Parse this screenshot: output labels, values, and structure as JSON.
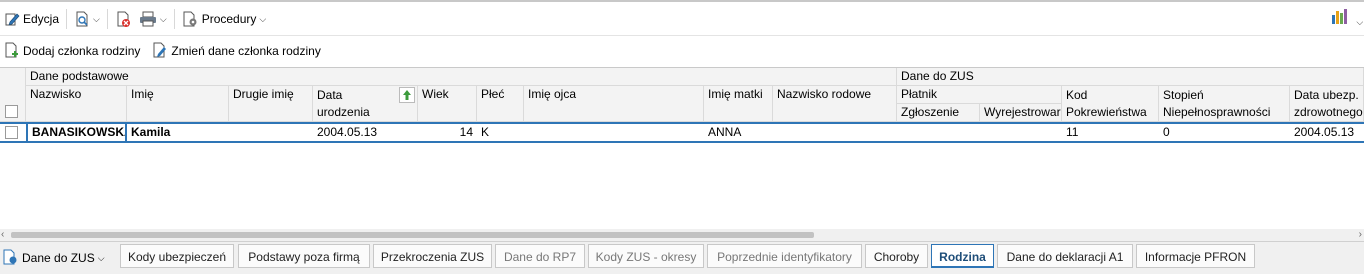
{
  "toolbar": {
    "edit_label": "Edycja",
    "procedures_label": "Procedury"
  },
  "actions": {
    "add_member": "Dodaj członka rodziny",
    "change_member": "Zmień dane członka rodziny"
  },
  "grid": {
    "group_basic": "Dane podstawowe",
    "group_zus": "Dane do ZUS",
    "col_nazwisko": "Nazwisko",
    "col_imie": "Imię",
    "col_drugie_imie": "Drugie imię",
    "col_data_line1": "Data",
    "col_data_line2": "urodzenia",
    "col_wiek": "Wiek",
    "col_plec": "Płeć",
    "col_imie_ojca": "Imię ojca",
    "col_imie_matki": "Imię matki",
    "col_nazwisko_rodowe": "Nazwisko rodowe",
    "col_platnik": "Płatnik",
    "col_zgloszenie": "Zgłoszenie",
    "col_wyrejestrowanie": "Wyrejestrowar",
    "col_kod_line1": "Kod",
    "col_kod_line2": "Pokrewieństwa",
    "col_stopien_line1": "Stopień",
    "col_stopien_line2": "Niepełnosprawności",
    "col_ubezp_line1": "Data ubezp.",
    "col_ubezp_line2": "zdrowotnego",
    "row": {
      "nazwisko": "BANASIKOWSKA",
      "imie": "Kamila",
      "drugie_imie": "",
      "data_urodzenia": "2004.05.13",
      "wiek": "14",
      "plec": "K",
      "imie_ojca": "",
      "imie_matki": "ANNA",
      "nazwisko_rodowe": "",
      "zgloszenie": "",
      "wyrejestrowanie": "",
      "kod": "11",
      "stopien": "0",
      "data_ubezp": "2004.05.13"
    }
  },
  "tabs": {
    "dropdown": "Dane do ZUS",
    "items": [
      "Kody ubezpieczeń",
      "Podstawy poza firmą",
      "Przekroczenia ZUS",
      "Dane do RP7",
      "Kody ZUS - okresy",
      "Poprzednie identyfikatory",
      "Choroby",
      "Rodzina",
      "Dane do deklaracji A1",
      "Informacje PFRON"
    ],
    "active": "Rodzina"
  }
}
